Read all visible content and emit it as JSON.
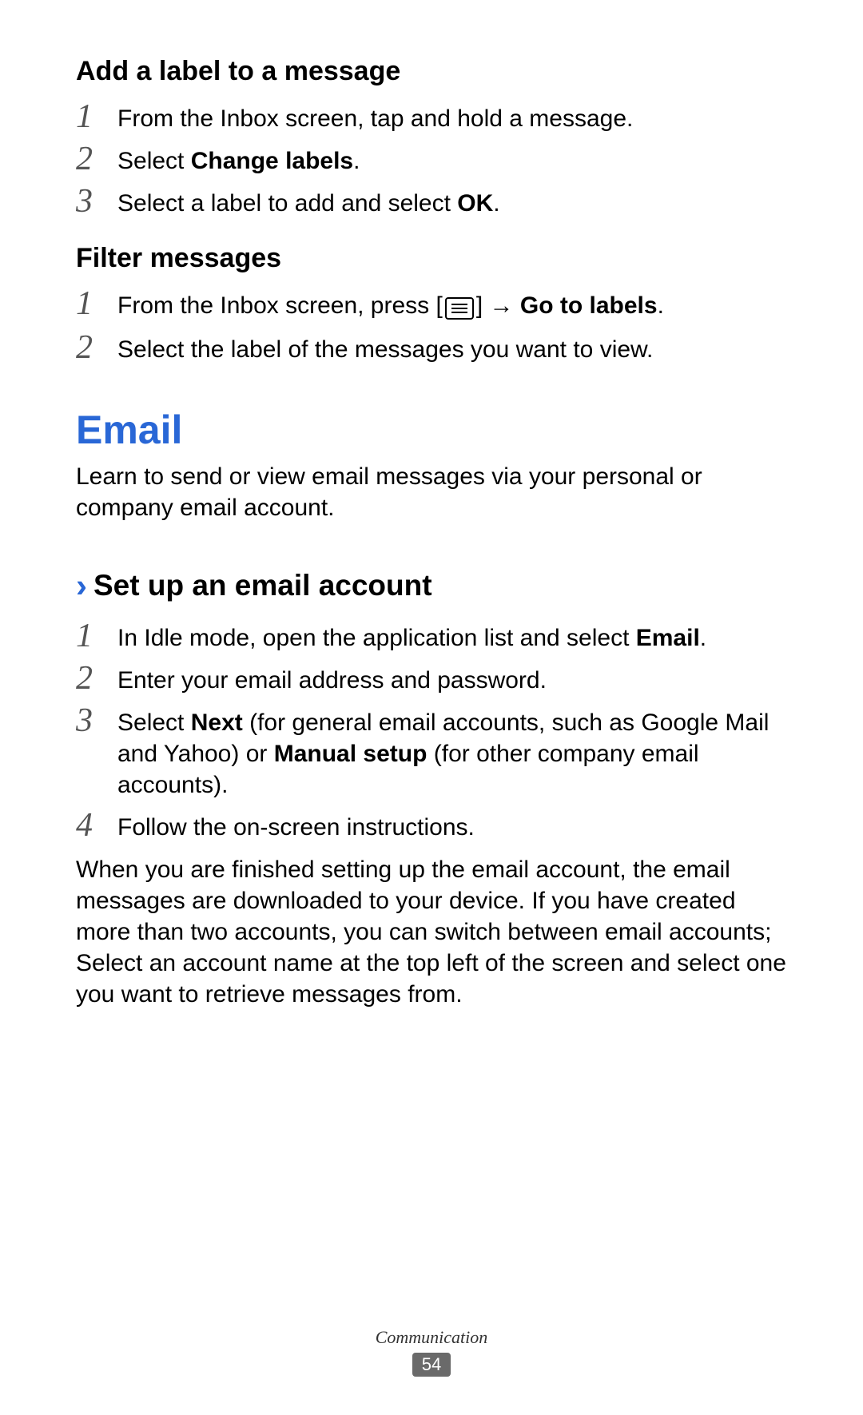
{
  "section1": {
    "title": "Add a label to a message",
    "steps": [
      {
        "num": "1",
        "text_plain": "From the Inbox screen, tap and hold a message."
      },
      {
        "num": "2",
        "text_html": "Select <b>Change labels</b>."
      },
      {
        "num": "3",
        "text_html": "Select a label to add and select <b>OK</b>."
      }
    ]
  },
  "section2": {
    "title": "Filter messages",
    "steps": [
      {
        "num": "1",
        "prefix": "From the Inbox screen, press [",
        "suffix_html": "] → <b>Go to labels</b>."
      },
      {
        "num": "2",
        "text_plain": "Select the label of the messages you want to view."
      }
    ]
  },
  "email": {
    "title": "Email",
    "intro": "Learn to send or view email messages via your personal or company email account."
  },
  "setup": {
    "chevron": "›",
    "title": "Set up an email account",
    "steps": [
      {
        "num": "1",
        "text_html": "In Idle mode, open the application list and select <b>Email</b>."
      },
      {
        "num": "2",
        "text_plain": "Enter your email address and password."
      },
      {
        "num": "3",
        "text_html": "Select <b>Next</b> (for general email accounts, such as Google Mail and Yahoo) or <b>Manual setup</b> (for other company email accounts)."
      },
      {
        "num": "4",
        "text_plain": "Follow the on-screen instructions."
      }
    ],
    "closing": "When you are finished setting up the email account, the email messages are downloaded to your device. If you have created more than two accounts, you can switch between email accounts; Select an account name at the top left of the screen and select one you want to retrieve messages from."
  },
  "footer": {
    "section": "Communication",
    "page": "54"
  }
}
